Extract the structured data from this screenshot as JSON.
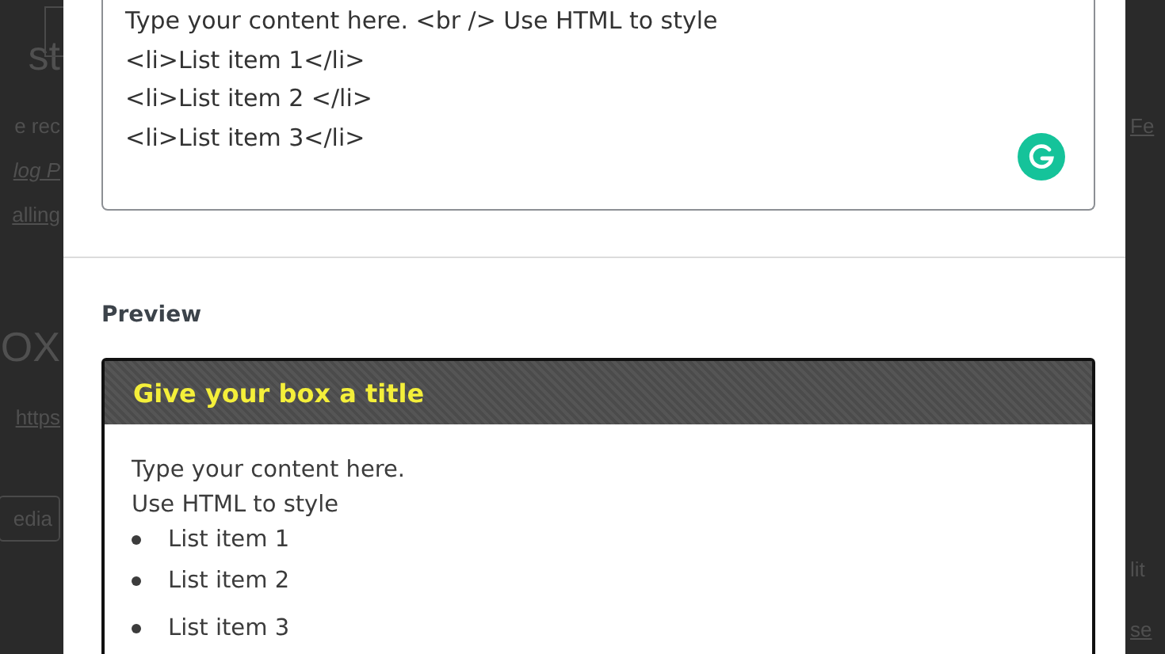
{
  "background_page": {
    "left_fragments": [
      {
        "kind": "heading",
        "text": "st"
      },
      {
        "kind": "text",
        "text": "e rec"
      },
      {
        "kind": "italic_link",
        "text": "log P"
      },
      {
        "kind": "link",
        "text": "alling"
      },
      {
        "kind": "heading",
        "text": "OX"
      },
      {
        "kind": "link",
        "text": "https"
      },
      {
        "kind": "button",
        "text": "edia"
      }
    ],
    "right_fragments": [
      {
        "kind": "link",
        "text": "Fe"
      },
      {
        "kind": "text",
        "text": "lit"
      },
      {
        "kind": "link",
        "text": "se"
      }
    ]
  },
  "editor": {
    "lines": [
      "Type your content here. <br /> Use HTML to style",
      "<li>List item 1</li>",
      "<li>List item 2 </li>",
      "<li>List item 3</li>"
    ]
  },
  "preview": {
    "heading": "Preview",
    "box_title": "Give your box a title",
    "body_lines": [
      "Type your content here.",
      "Use HTML to style"
    ],
    "list_items": [
      "List item 1",
      "List item 2",
      "List item 3"
    ]
  }
}
